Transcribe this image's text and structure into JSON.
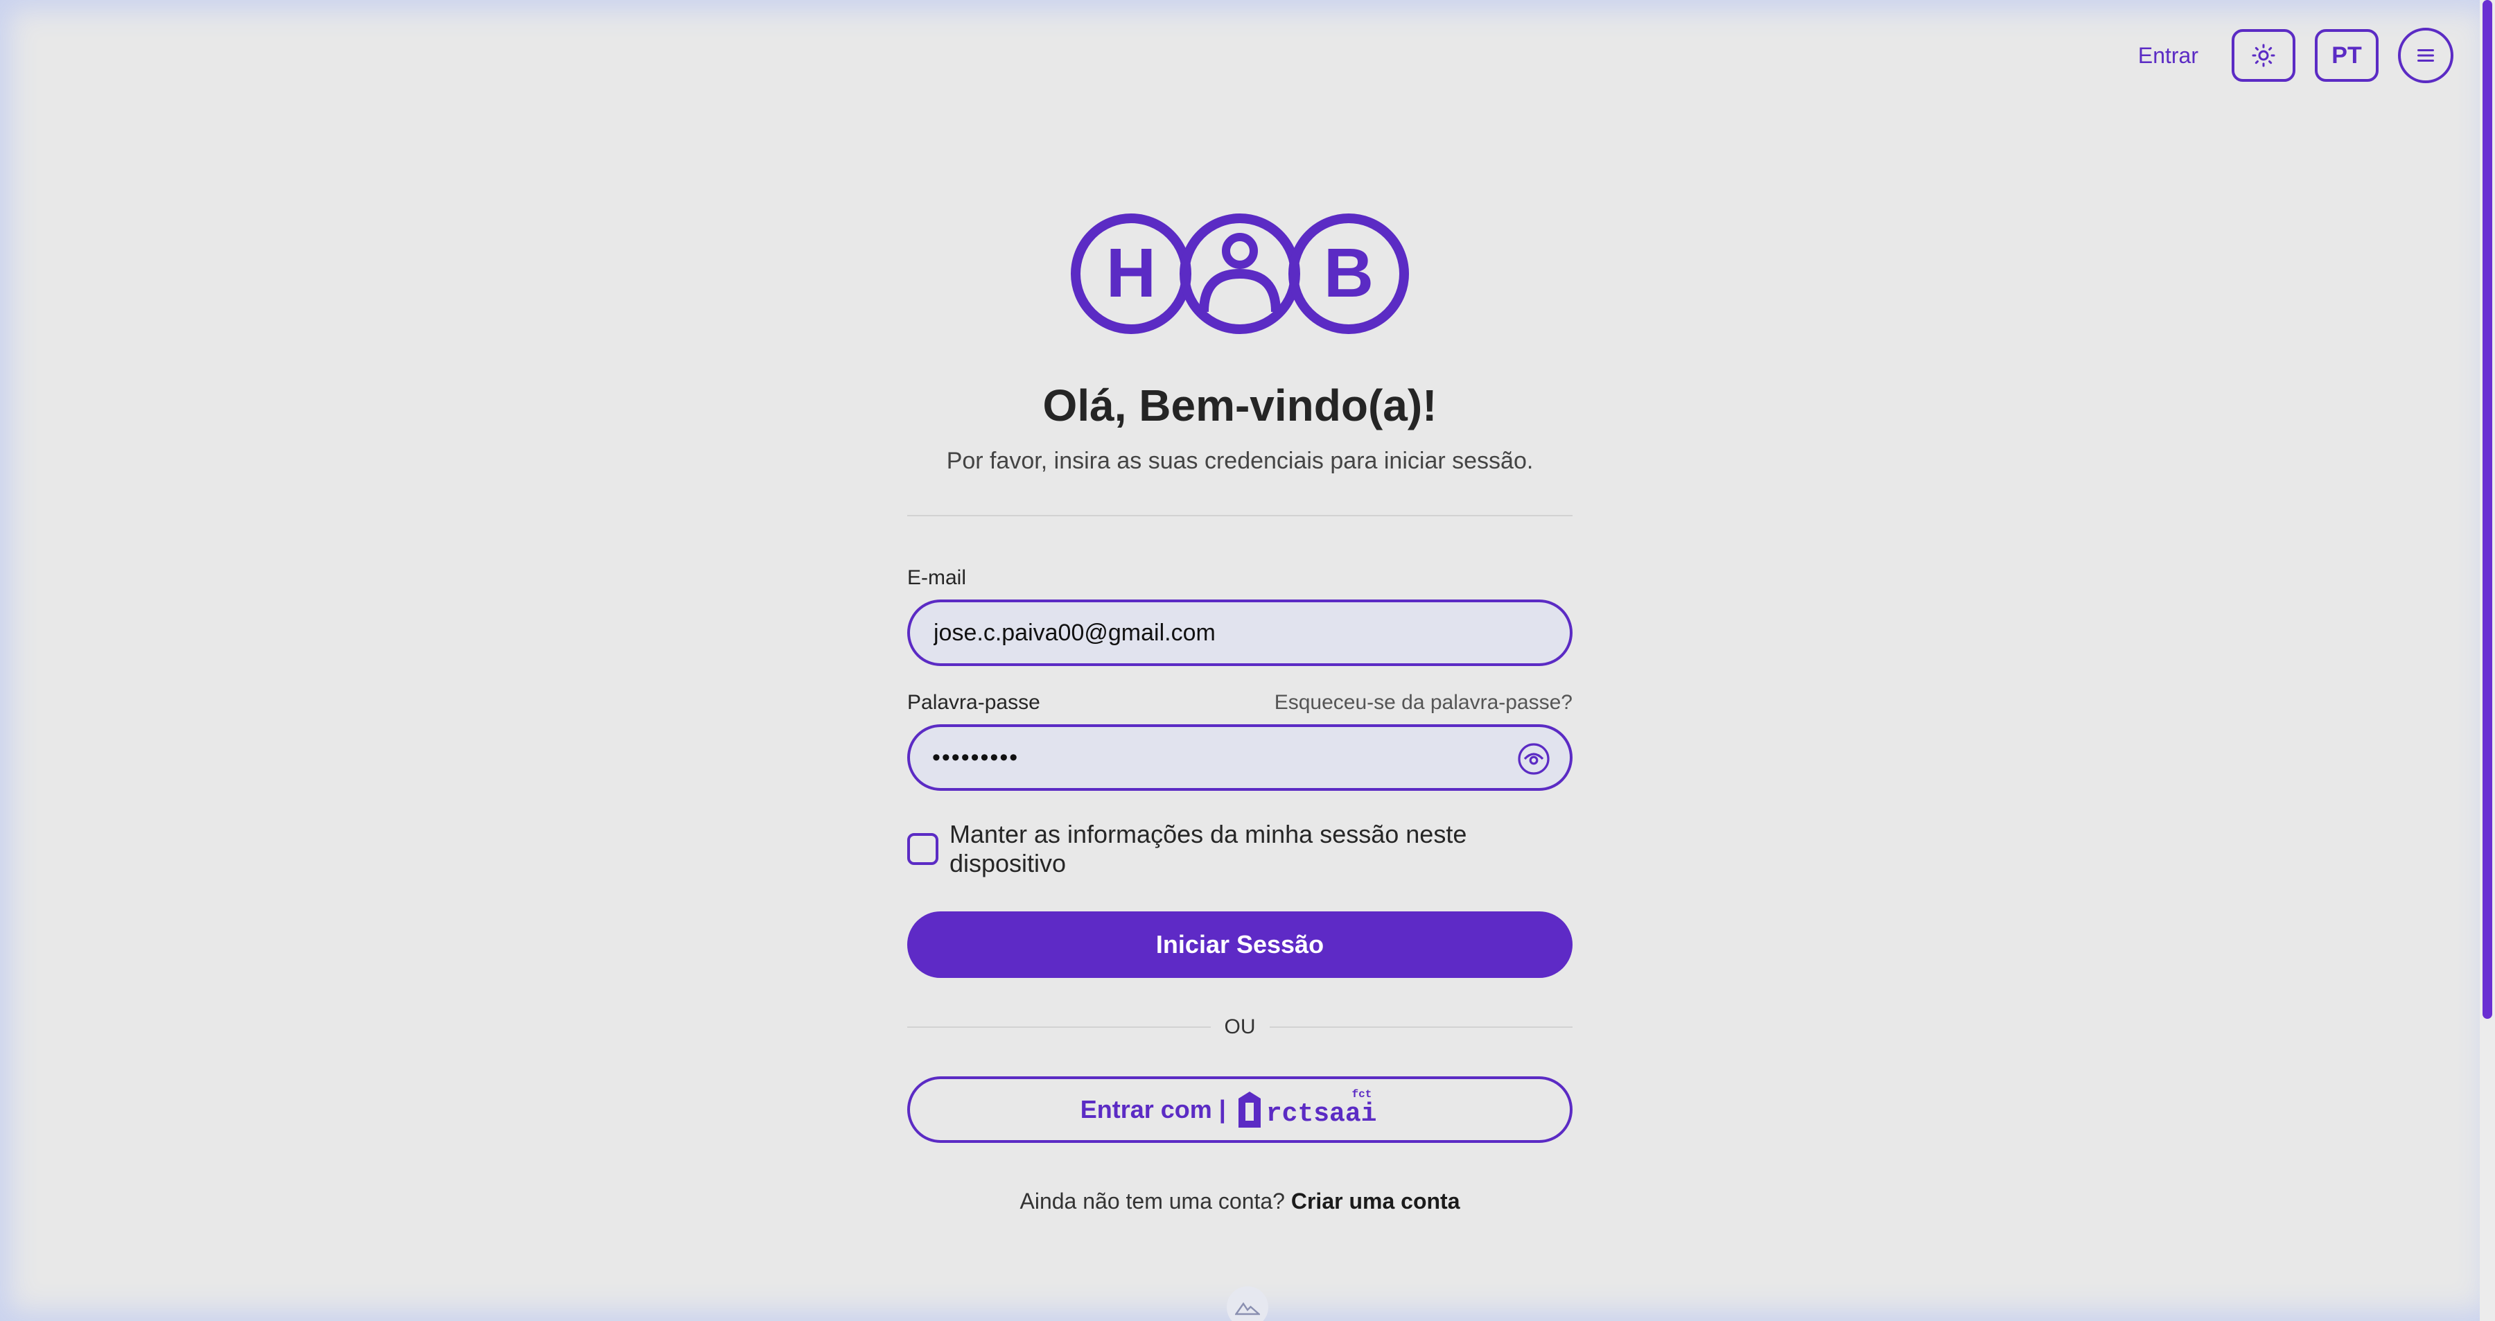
{
  "nav": {
    "login_link": "Entrar",
    "theme_icon": "sun-icon",
    "language": "PT",
    "menu_icon": "hamburger-menu-icon"
  },
  "brand": {
    "logo_letters": [
      "H",
      "B"
    ],
    "logo_color": "#5b2bc4"
  },
  "header": {
    "title": "Olá, Bem-vindo(a)!",
    "subtitle": "Por favor, insira as suas credenciais para iniciar sessão."
  },
  "form": {
    "email_label": "E-mail",
    "email_value": "jose.c.paiva00@gmail.com",
    "password_label": "Palavra-passe",
    "forgot_link": "Esqueceu-se da palavra-passe?",
    "password_value": "•••••••••",
    "password_toggle_icon": "eye-icon",
    "remember_label": "Manter as informações da minha sessão neste dispositivo",
    "remember_checked": false,
    "submit_label": "Iniciar Sessão",
    "or_text": "OU",
    "sso_label": "Entrar com |",
    "sso_provider": "rctsaai",
    "sso_provider_sup": "fct"
  },
  "signup": {
    "prompt": "Ainda não tem uma conta?",
    "link": "Criar uma conta"
  },
  "colors": {
    "accent": "#5b2bc4",
    "primary_button": "#5e2ac6",
    "background": "#e8e8e8",
    "field_bg": "#e1e3ee"
  }
}
